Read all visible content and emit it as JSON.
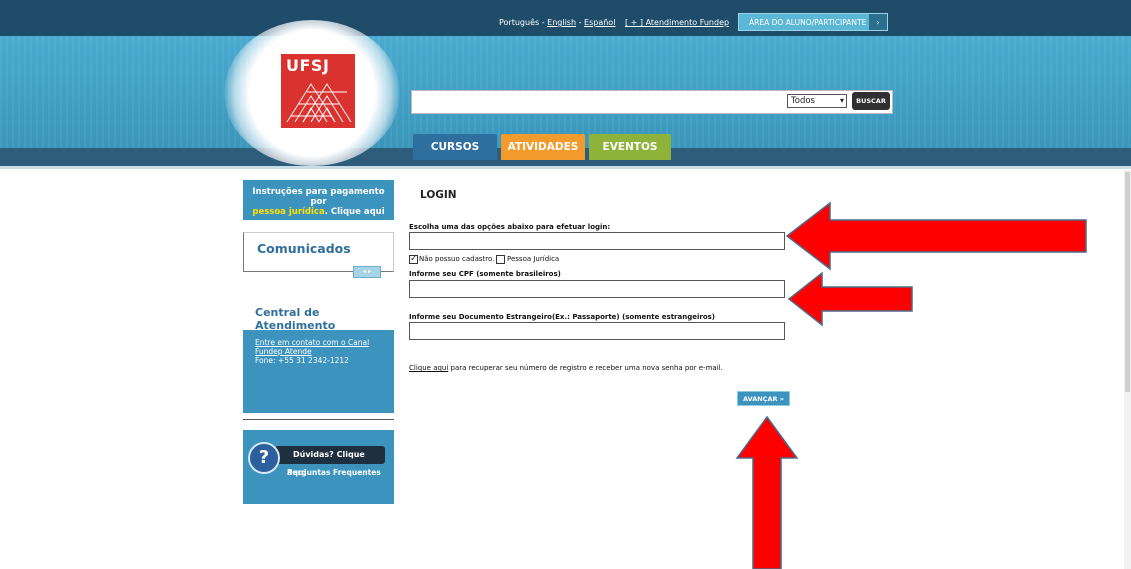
{
  "topbar": {
    "lang_pt": "Português",
    "lang_sep1": " - ",
    "lang_en": "English",
    "lang_sep2": " - ",
    "lang_es": "Español",
    "atendimento": "[ + ] Atendimento Fundep",
    "area_button": "ÁREA DO ALUNO/PARTICIPANTE",
    "area_chevron": "›"
  },
  "logo": {
    "text": "UFSJ"
  },
  "search": {
    "select_value": "Todos",
    "select_arrow": "▾",
    "button": "BUSCAR"
  },
  "tabs": [
    "CURSOS",
    "ATIVIDADES",
    "EVENTOS"
  ],
  "sidebar": {
    "instr_line1": "Instruções para pagamento por",
    "instr_hl": "pessoa jurídica",
    "instr_line2": ". Clique aqui",
    "comunicados_title": "Comunicados",
    "comunicados_nav": "◂ ▸",
    "central_title": "Central de Atendimento",
    "central_link1": "Entre em contato com o Canal",
    "central_link2": "Fundep Atende",
    "central_phone": "Fone: +55 31 2342-1212",
    "duvidas_q": "?",
    "duvidas_label": "Dúvidas? Clique aqui",
    "duvidas_sub": "Perguntas Frequentes"
  },
  "login": {
    "title": "LOGIN",
    "choose_label": "Escolha uma das opções abaixo para efetuar login:",
    "cb1_mark": "✓",
    "cb1_label": "Não possuo cadastro.",
    "cb2_label": "Pessoa Jurídica",
    "cpf_label": "Informe seu CPF (somente brasileiros)",
    "foreign_label": "Informe seu Documento Estrangeiro(Ex.: Passaporte) (somente estrangeiros)",
    "recover_link": "Clique aqui",
    "recover_text": " para recuperar seu número de registro e receber uma nova senha por e-mail.",
    "next_button": "AVANÇAR »"
  },
  "colors": {
    "topbar": "#1f4d69",
    "header": "#3f9fc4",
    "tab_cursos": "#2f6fa0",
    "tab_atividades": "#f29a2c",
    "tab_eventos": "#8fb23a",
    "annotation_arrow": "#ff0000"
  }
}
